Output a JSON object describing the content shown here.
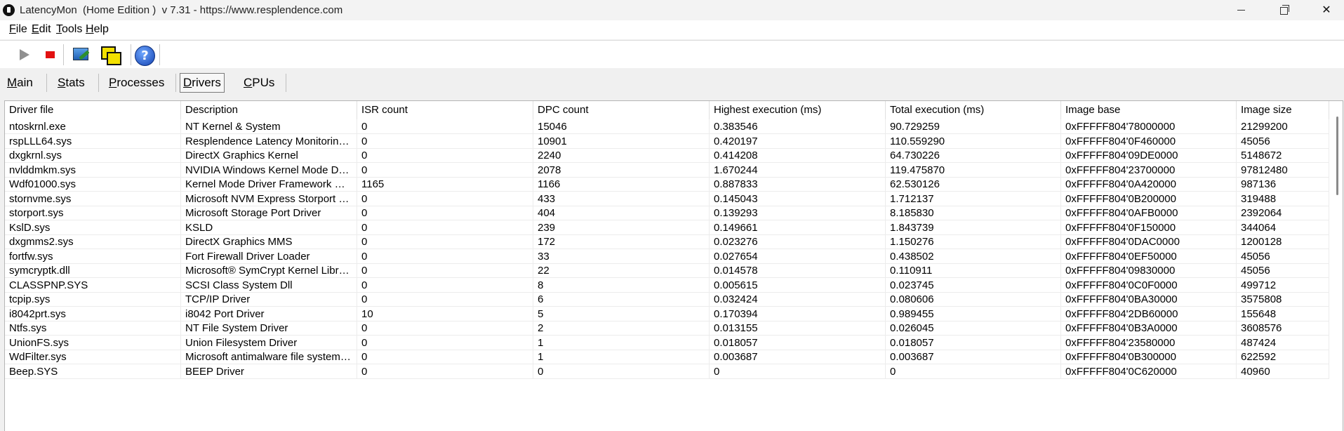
{
  "window": {
    "title": "LatencyMon  (Home Edition )  v 7.31 - https://www.resplendence.com"
  },
  "menu": {
    "items": [
      {
        "acc": "F",
        "rest": "ile"
      },
      {
        "acc": "E",
        "rest": "dit"
      },
      {
        "acc": "T",
        "rest": "ools"
      },
      {
        "acc": "H",
        "rest": "elp"
      }
    ]
  },
  "toolbar": {
    "icons": [
      "play-icon",
      "stop-icon",
      "check-drivers-icon",
      "windows-icon",
      "help-icon"
    ],
    "help_glyph": "?"
  },
  "tabs": [
    {
      "acc": "M",
      "rest": "ain"
    },
    {
      "acc": "S",
      "rest": "tats"
    },
    {
      "acc": "P",
      "rest": "rocesses"
    },
    {
      "acc": "D",
      "rest": "rivers"
    },
    {
      "acc": "C",
      "rest": "PUs"
    }
  ],
  "active_tab": "Drivers",
  "table": {
    "columns": [
      "Driver file",
      "Description",
      "ISR count",
      "DPC count",
      "Highest execution (ms)",
      "Total execution (ms)",
      "Image base",
      "Image size"
    ],
    "rows": [
      [
        "ntoskrnl.exe",
        "NT Kernel & System",
        "0",
        "15046",
        "0.383546",
        "90.729259",
        "0xFFFFF804'78000000",
        "21299200"
      ],
      [
        "rspLLL64.sys",
        "Resplendence Latency Monitoring and Auxiliary Kernel Library",
        "0",
        "10901",
        "0.420197",
        "110.559290",
        "0xFFFFF804'0F460000",
        "45056"
      ],
      [
        "dxgkrnl.sys",
        "DirectX Graphics Kernel",
        "0",
        "2240",
        "0.414208",
        "64.730226",
        "0xFFFFF804'09DE0000",
        "5148672"
      ],
      [
        "nvlddmkm.sys",
        "NVIDIA Windows Kernel Mode Driver",
        "0",
        "2078",
        "1.670244",
        "119.475870",
        "0xFFFFF804'23700000",
        "97812480"
      ],
      [
        "Wdf01000.sys",
        "Kernel Mode Driver Framework Runtime",
        "1165",
        "1166",
        "0.887833",
        "62.530126",
        "0xFFFFF804'0A420000",
        "987136"
      ],
      [
        "stornvme.sys",
        "Microsoft NVM Express Storport Miniport Driver",
        "0",
        "433",
        "0.145043",
        "1.712137",
        "0xFFFFF804'0B200000",
        "319488"
      ],
      [
        "storport.sys",
        "Microsoft Storage Port Driver",
        "0",
        "404",
        "0.139293",
        "8.185830",
        "0xFFFFF804'0AFB0000",
        "2392064"
      ],
      [
        "KslD.sys",
        "KSLD",
        "0",
        "239",
        "0.149661",
        "1.843739",
        "0xFFFFF804'0F150000",
        "344064"
      ],
      [
        "dxgmms2.sys",
        "DirectX Graphics MMS",
        "0",
        "172",
        "0.023276",
        "1.150276",
        "0xFFFFF804'0DAC0000",
        "1200128"
      ],
      [
        "fortfw.sys",
        "Fort Firewall Driver Loader",
        "0",
        "33",
        "0.027654",
        "0.438502",
        "0xFFFFF804'0EF50000",
        "45056"
      ],
      [
        "symcryptk.dll",
        "Microsoft® SymCrypt Kernel Library",
        "0",
        "22",
        "0.014578",
        "0.110911",
        "0xFFFFF804'09830000",
        "45056"
      ],
      [
        "CLASSPNP.SYS",
        "SCSI Class System Dll",
        "0",
        "8",
        "0.005615",
        "0.023745",
        "0xFFFFF804'0C0F0000",
        "499712"
      ],
      [
        "tcpip.sys",
        "TCP/IP Driver",
        "0",
        "6",
        "0.032424",
        "0.080606",
        "0xFFFFF804'0BA30000",
        "3575808"
      ],
      [
        "i8042prt.sys",
        "i8042 Port Driver",
        "10",
        "5",
        "0.170394",
        "0.989455",
        "0xFFFFF804'2DB60000",
        "155648"
      ],
      [
        "Ntfs.sys",
        "NT File System Driver",
        "0",
        "2",
        "0.013155",
        "0.026045",
        "0xFFFFF804'0B3A0000",
        "3608576"
      ],
      [
        "UnionFS.sys",
        "Union Filesystem Driver",
        "0",
        "1",
        "0.018057",
        "0.018057",
        "0xFFFFF804'23580000",
        "487424"
      ],
      [
        "WdFilter.sys",
        "Microsoft antimalware file system filter driver",
        "0",
        "1",
        "0.003687",
        "0.003687",
        "0xFFFFF804'0B300000",
        "622592"
      ],
      [
        "Beep.SYS",
        "BEEP Driver",
        "0",
        "0",
        "0",
        "0",
        "0xFFFFF804'0C620000",
        "40960"
      ]
    ]
  }
}
